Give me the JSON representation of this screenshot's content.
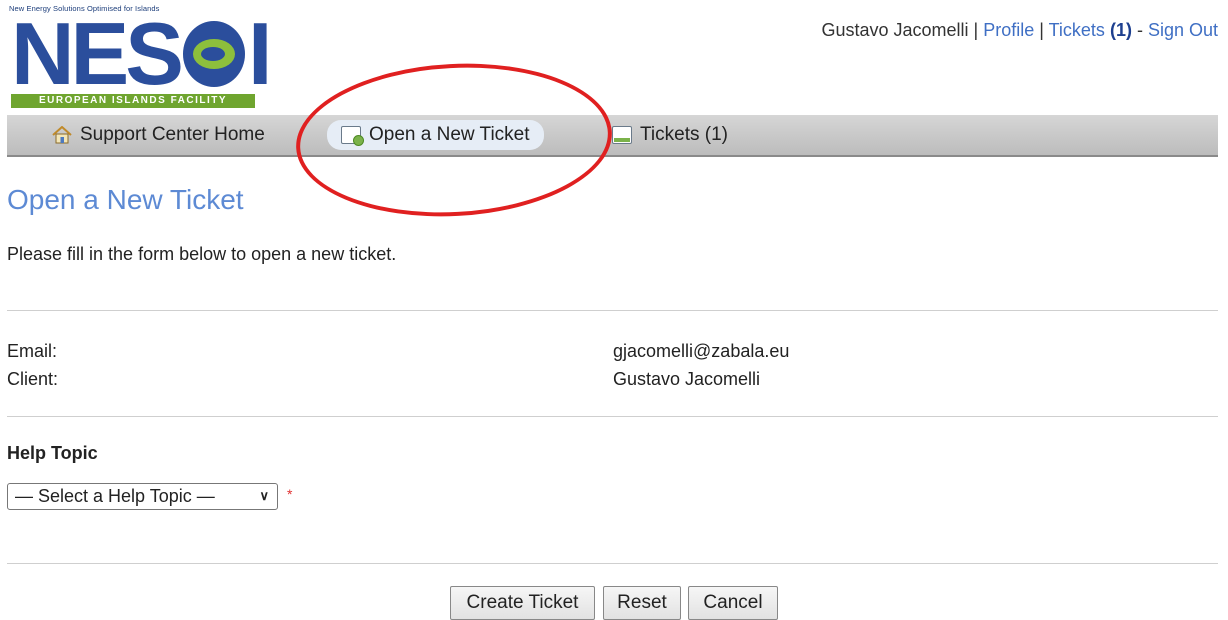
{
  "logo": {
    "tagline": "New Energy Solutions Optimised for Islands",
    "word_left": "NES",
    "word_right": "I",
    "bar": "EUROPEAN ISLANDS FACILITY"
  },
  "userbar": {
    "user_name": "Gustavo Jacomelli",
    "sep1": " | ",
    "profile": "Profile",
    "sep2": " | ",
    "tickets": "Tickets",
    "tickets_count": "(1)",
    "sep3": " - ",
    "sign_out": "Sign Out"
  },
  "nav": {
    "items": [
      {
        "label": "Support Center Home",
        "icon": "home-icon"
      },
      {
        "label": "Open a New Ticket",
        "icon": "new-ticket-icon"
      },
      {
        "label": "Tickets (1)",
        "icon": "tickets-icon"
      }
    ]
  },
  "page": {
    "title": "Open a New Ticket",
    "intro": "Please fill in the form below to open a new ticket."
  },
  "form": {
    "email_label": "Email:",
    "email_value": "gjacomelli@zabala.eu",
    "client_label": "Client:",
    "client_value": "Gustavo Jacomelli",
    "help_topic_heading": "Help Topic",
    "help_topic_selected": "— Select a Help Topic —",
    "required_mark": "*"
  },
  "buttons": {
    "create": "Create Ticket",
    "reset": "Reset",
    "cancel": "Cancel"
  },
  "colors": {
    "accent_link": "#3f6fc4",
    "title": "#5d8ad4",
    "logo_blue": "#2b4e9c",
    "logo_green": "#6fa52f",
    "annotation": "#e02020"
  }
}
